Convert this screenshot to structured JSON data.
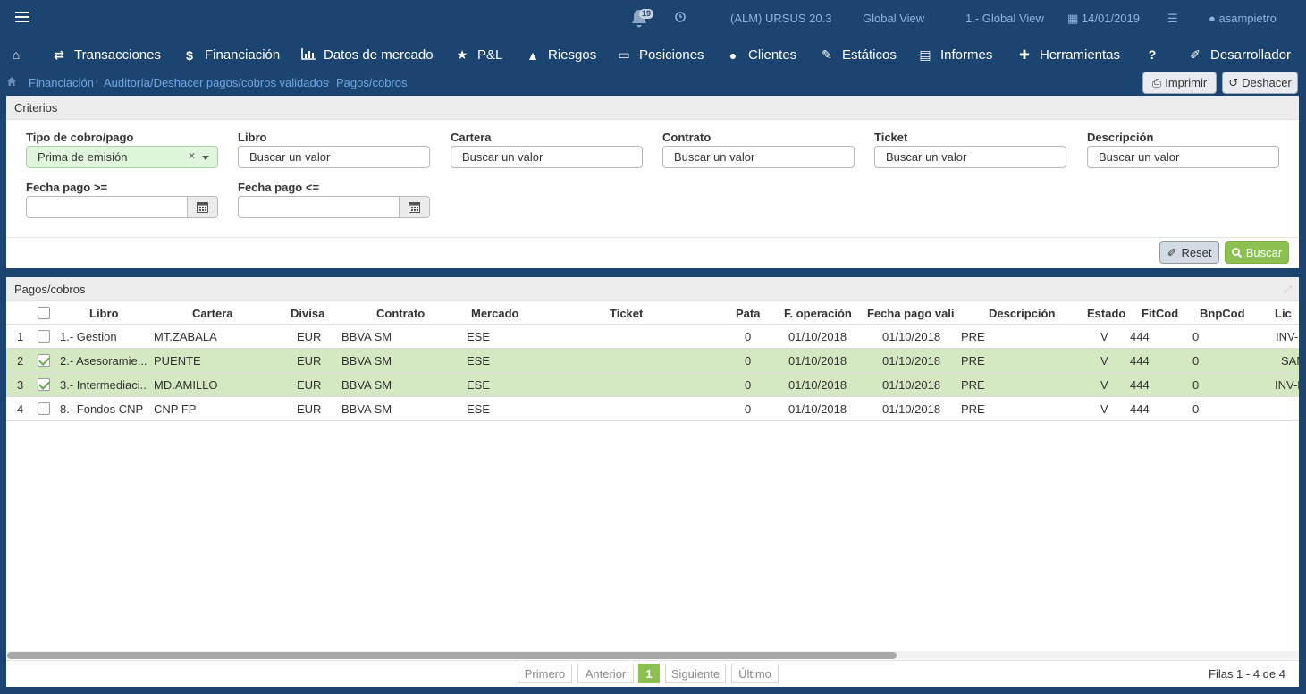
{
  "topbar": {
    "notifications_count": "19",
    "app_name": "(ALM) URSUS 20.3",
    "view_label": "Global View",
    "view_selector": "1.- Global View",
    "date": "14/01/2019",
    "user": "asampietro"
  },
  "nav": {
    "items": [
      {
        "label": ""
      },
      {
        "label": "Transacciones"
      },
      {
        "label": "Financiación"
      },
      {
        "label": "Datos de mercado"
      },
      {
        "label": "P&L"
      },
      {
        "label": "Riesgos"
      },
      {
        "label": "Posiciones"
      },
      {
        "label": "Clientes"
      },
      {
        "label": "Estáticos"
      },
      {
        "label": "Informes"
      },
      {
        "label": "Herramientas"
      },
      {
        "label": ""
      },
      {
        "label": "Desarrollador"
      }
    ]
  },
  "breadcrumb": {
    "items": [
      "Financiación",
      "Auditoría/Deshacer pagos/cobros validados",
      "Pagos/cobros"
    ]
  },
  "actions": {
    "print_label": "Imprimir",
    "undo_label": "Deshacer"
  },
  "criteria": {
    "title": "Criterios",
    "tipo_label": "Tipo de cobro/pago",
    "tipo_value": "Prima de emisión",
    "libro_label": "Libro",
    "libro_placeholder": "Buscar un valor",
    "cartera_label": "Cartera",
    "cartera_placeholder": "Buscar un valor",
    "contrato_label": "Contrato",
    "contrato_placeholder": "Buscar un valor",
    "ticket_label": "Ticket",
    "ticket_placeholder": "Buscar un valor",
    "descripcion_label": "Descripción",
    "descripcion_placeholder": "Buscar un valor",
    "fecha_desde_label": "Fecha pago >=",
    "fecha_hasta_label": "Fecha pago <=",
    "fecha_desde_value": "",
    "fecha_hasta_value": "",
    "reset_label": "Reset",
    "buscar_label": "Buscar"
  },
  "results": {
    "title": "Pagos/cobros",
    "columns": [
      "Libro",
      "Cartera",
      "Divisa",
      "Contrato",
      "Mercado",
      "Ticket",
      "Pata",
      "F. operación",
      "Fecha pago valic",
      "Descripción",
      "Estado",
      "FitCod",
      "BnpCod",
      "Lic"
    ],
    "rows": [
      {
        "num": "1",
        "checked": false,
        "libro": "1.- Gestion",
        "cartera": "MT.ZABALA",
        "divisa": "EUR",
        "contrato": "BBVA SM",
        "mercado": "ESE",
        "ticket": "",
        "pata": "0",
        "f_operacion": "01/10/2018",
        "fecha_pago": "01/10/2018",
        "descripcion": "PRE",
        "estado": "V",
        "fitcod": "444",
        "bnpcod": "0",
        "lic": "INV-I"
      },
      {
        "num": "2",
        "checked": true,
        "libro": "2.- Asesoramie...",
        "cartera": "PUENTE",
        "divisa": "EUR",
        "contrato": "BBVA SM",
        "mercado": "ESE",
        "ticket": "",
        "pata": "0",
        "f_operacion": "01/10/2018",
        "fecha_pago": "01/10/2018",
        "descripcion": "PRE",
        "estado": "V",
        "fitcod": "444",
        "bnpcod": "0",
        "lic": "SAN"
      },
      {
        "num": "3",
        "checked": true,
        "libro": "3.- Intermediaci...",
        "cartera": "MD.AMILLO",
        "divisa": "EUR",
        "contrato": "BBVA SM",
        "mercado": "ESE",
        "ticket": "",
        "pata": "0",
        "f_operacion": "01/10/2018",
        "fecha_pago": "01/10/2018",
        "descripcion": "PRE",
        "estado": "V",
        "fitcod": "444",
        "bnpcod": "0",
        "lic": "INV-N"
      },
      {
        "num": "4",
        "checked": false,
        "libro": "8.- Fondos CNP",
        "cartera": "CNP FP",
        "divisa": "EUR",
        "contrato": "BBVA SM",
        "mercado": "ESE",
        "ticket": "",
        "pata": "0",
        "f_operacion": "01/10/2018",
        "fecha_pago": "01/10/2018",
        "descripcion": "PRE",
        "estado": "V",
        "fitcod": "444",
        "bnpcod": "0",
        "lic": ""
      }
    ]
  },
  "pager": {
    "first": "Primero",
    "prev": "Anterior",
    "current": "1",
    "next": "Siguiente",
    "last": "Último",
    "info": "Filas 1 - 4 de 4"
  }
}
